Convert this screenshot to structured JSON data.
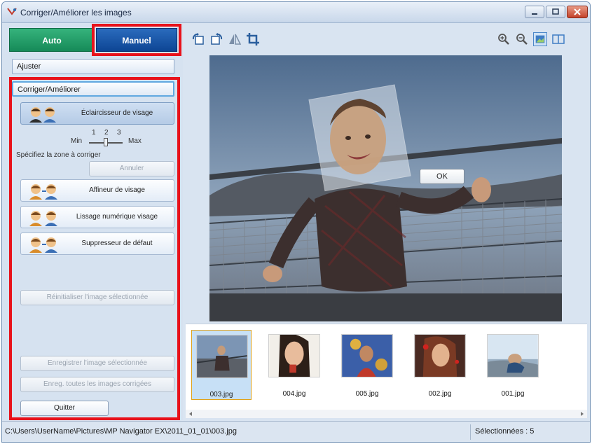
{
  "window": {
    "title": "Corriger/Améliorer les images"
  },
  "tabs": {
    "auto": "Auto",
    "manual": "Manuel"
  },
  "sections": {
    "adjust": "Ajuster",
    "correct": "Corriger/Améliorer"
  },
  "tools": {
    "face_brightener": "Éclaircisseur de visage",
    "slider_min": "Min",
    "slider_max": "Max",
    "slider_ticks": [
      "1",
      "2",
      "3"
    ],
    "slider_level": 2,
    "specify_area": "Spécifiez la zone à corriger",
    "cancel": "Annuler",
    "face_sharpener": "Affineur de visage",
    "digital_face_smoothing": "Lissage numérique visage",
    "blemish_remover": "Suppresseur de défaut",
    "reset_selected": "Réinitialiser l'image sélectionnée"
  },
  "actions": {
    "save_selected": "Enregistrer l'image sélectionnée",
    "save_all": "Enreg. toutes les images corrigées",
    "quit": "Quitter"
  },
  "preview": {
    "ok": "OK"
  },
  "thumbnails": [
    {
      "name": "003.jpg",
      "selected": true
    },
    {
      "name": "004.jpg",
      "selected": false
    },
    {
      "name": "005.jpg",
      "selected": false
    },
    {
      "name": "002.jpg",
      "selected": false
    },
    {
      "name": "001.jpg",
      "selected": false
    }
  ],
  "status": {
    "path": "C:\\Users\\UserName\\Pictures\\MP Navigator EX\\2011_01_01\\003.jpg",
    "selected": "Sélectionnées : 5"
  },
  "colors": {
    "highlight": "#e8121b",
    "auto_tab": "#168a58",
    "manual_tab": "#0d4594"
  }
}
